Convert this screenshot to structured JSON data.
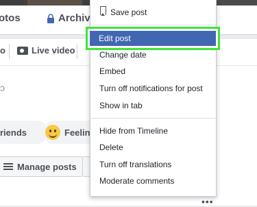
{
  "background": {
    "tabs": [
      {
        "label": "otos"
      },
      {
        "label": "Archiv"
      }
    ],
    "composer": {
      "live_video": "Live video",
      "friends_label": "riends",
      "feeling_label": "Feelin",
      "manage_posts": "Manage posts"
    }
  },
  "menu": {
    "save_post": "Save post",
    "selected_item": "Edit post",
    "items": [
      "Change date",
      "Embed",
      "Turn off notifications for post",
      "Show in tab",
      "Hide from Timeline",
      "Delete",
      "Turn off translations",
      "Moderate comments"
    ]
  },
  "colors": {
    "highlight": "#4267b2",
    "annotation": "#3fe535"
  }
}
